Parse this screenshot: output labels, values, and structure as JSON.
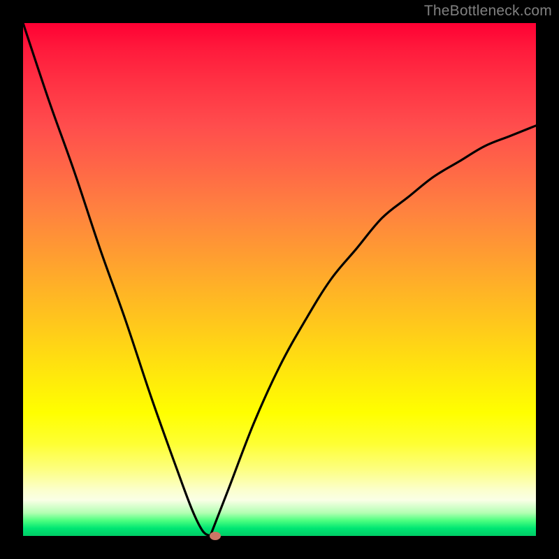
{
  "watermark": "TheBottleneck.com",
  "colors": {
    "frame": "#000000",
    "curve_stroke": "#000000",
    "marker_fill": "#cc7766",
    "watermark_text": "#808080"
  },
  "chart_data": {
    "type": "line",
    "title": "",
    "xlabel": "",
    "ylabel": "",
    "xlim": [
      0,
      100
    ],
    "ylim": [
      0,
      100
    ],
    "grid": false,
    "legend": false,
    "series": [
      {
        "name": "bottleneck-curve-left",
        "x": [
          0,
          5,
          10,
          15,
          20,
          25,
          30,
          33,
          35,
          36.5
        ],
        "values": [
          100,
          85,
          71,
          56,
          42,
          27,
          13,
          5,
          1,
          0
        ]
      },
      {
        "name": "bottleneck-curve-right",
        "x": [
          36.5,
          40,
          45,
          50,
          55,
          60,
          65,
          70,
          75,
          80,
          85,
          90,
          95,
          100
        ],
        "values": [
          0,
          9,
          22,
          33,
          42,
          50,
          56,
          62,
          66,
          70,
          73,
          76,
          78,
          80
        ]
      }
    ],
    "marker": {
      "x": 37.5,
      "y": 0
    },
    "gradient_stops": [
      {
        "pct": 0,
        "color": "#ff0033"
      },
      {
        "pct": 20,
        "color": "#ff4d4d"
      },
      {
        "pct": 44,
        "color": "#ff9933"
      },
      {
        "pct": 76,
        "color": "#ffff00"
      },
      {
        "pct": 93,
        "color": "#faffe6"
      },
      {
        "pct": 100,
        "color": "#00cc66"
      }
    ]
  }
}
